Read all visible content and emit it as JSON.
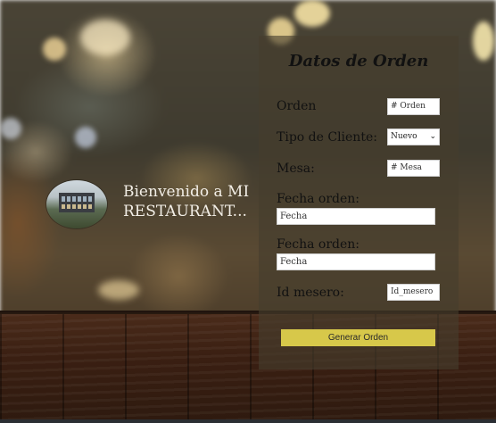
{
  "welcome": {
    "line1": "Bienvenido a  MI",
    "line2": "RESTAURANT..."
  },
  "form": {
    "title": "Datos de Orden",
    "orden": {
      "label": "Orden",
      "placeholder": "# Orden"
    },
    "tipo_cliente": {
      "label": "Tipo de Cliente:",
      "selected": "Nuevo"
    },
    "mesa": {
      "label": "Mesa:",
      "placeholder": "# Mesa"
    },
    "fecha1": {
      "label": "Fecha orden:",
      "placeholder": "Fecha"
    },
    "fecha2": {
      "label": "Fecha orden:",
      "placeholder": "Fecha"
    },
    "mesero": {
      "label": "Id mesero:",
      "placeholder": "Id_mesero"
    },
    "submit_label": "Generar Orden"
  },
  "colors": {
    "button": "#d7c84a",
    "panel": "rgba(70,62,45,0.62)"
  }
}
